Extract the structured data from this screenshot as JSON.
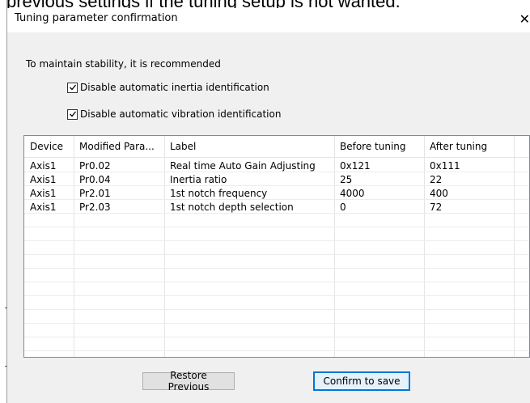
{
  "background_text": "previous settings if the tuning setup is not wanted.",
  "dialog": {
    "title": "Tuning parameter confirmation",
    "close_glyph": "✕",
    "intro_text": "To maintain stability, it is recommended",
    "checkboxes": [
      {
        "label": "Disable automatic inertia identification",
        "checked": true
      },
      {
        "label": "Disable automatic vibration identification",
        "checked": true
      }
    ],
    "table": {
      "columns": [
        "Device",
        "Modified Para...",
        "Label",
        "Before tuning",
        "After tuning"
      ],
      "rows": [
        [
          "Axis1",
          "Pr0.02",
          "Real time Auto Gain Adjusting",
          "0x121",
          "0x111"
        ],
        [
          "Axis1",
          "Pr0.04",
          "Inertia ratio",
          "25",
          "22"
        ],
        [
          "Axis1",
          "Pr2.01",
          "1st notch frequency",
          "4000",
          "400"
        ],
        [
          "Axis1",
          "Pr2.03",
          "1st notch depth selection",
          "0",
          "72"
        ]
      ]
    },
    "buttons": {
      "restore": "Restore Previous",
      "confirm": "Confirm to save"
    },
    "colors": {
      "accent": "#0078d7",
      "dialog_bg": "#f0f0f0",
      "button_bg": "#e1e1e1"
    },
    "icons": {
      "check": "check-icon",
      "close": "close-icon"
    }
  }
}
